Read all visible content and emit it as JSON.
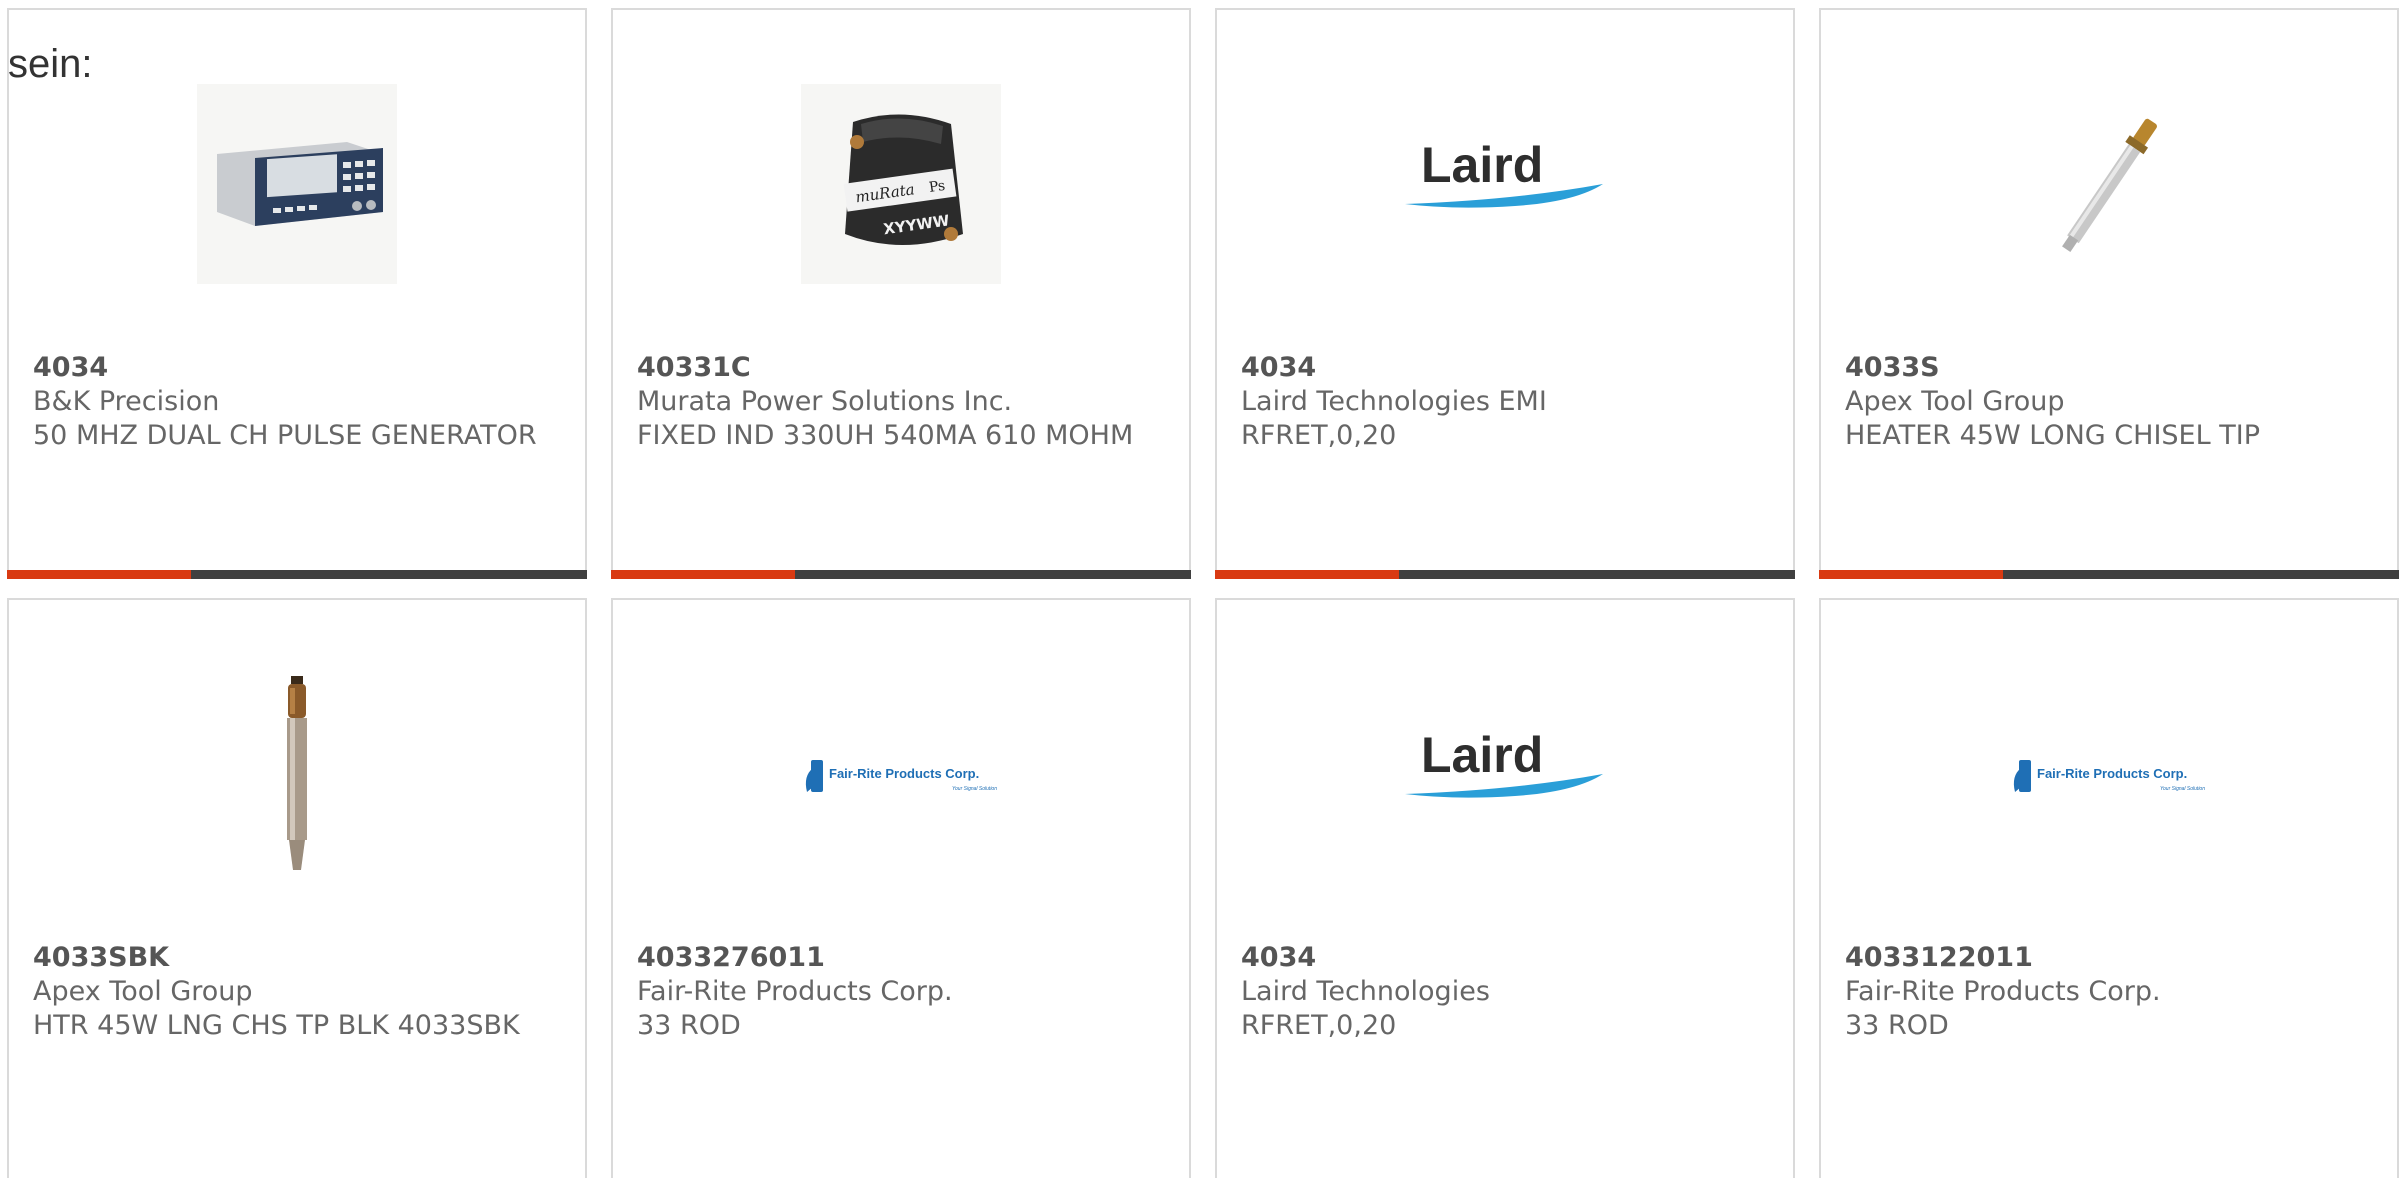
{
  "heading": "sein:",
  "colors": {
    "accent": "#d93a12",
    "bar": "#404040",
    "border": "#dadada",
    "laird_blue": "#2a9fd8",
    "fairrite_blue": "#1f6fb5"
  },
  "products": [
    {
      "part_number": "4034",
      "manufacturer": "B&K Precision",
      "description": "50 MHZ DUAL CH PULSE GENERATOR",
      "image_icon": "pulse-generator-icon"
    },
    {
      "part_number": "40331C",
      "manufacturer": "Murata Power Solutions Inc.",
      "description": "FIXED IND 330UH 540MA 610 MOHM",
      "image_icon": "inductor-icon",
      "image_text": [
        "muRata",
        "Ps",
        "XYYWW"
      ]
    },
    {
      "part_number": "4034",
      "manufacturer": "Laird Technologies EMI",
      "description": "RFRET,0,20",
      "image_icon": "laird-logo-icon",
      "image_text": [
        "Laird"
      ]
    },
    {
      "part_number": "4033S",
      "manufacturer": "Apex Tool Group",
      "description": "HEATER 45W LONG CHISEL TIP",
      "image_icon": "soldering-heater-icon"
    },
    {
      "part_number": "4033SBK",
      "manufacturer": "Apex Tool Group",
      "description": "HTR 45W LNG CHS TP BLK 4033SBK",
      "image_icon": "soldering-tip-icon"
    },
    {
      "part_number": "4033276011",
      "manufacturer": "Fair-Rite Products Corp.",
      "description": "33 ROD",
      "image_icon": "fair-rite-logo-icon",
      "image_text": [
        "Fair-Rite Products Corp.",
        "Your Signal Solution"
      ]
    },
    {
      "part_number": "4034",
      "manufacturer": "Laird Technologies",
      "description": "RFRET,0,20",
      "image_icon": "laird-logo-icon",
      "image_text": [
        "Laird"
      ]
    },
    {
      "part_number": "4033122011",
      "manufacturer": "Fair-Rite Products Corp.",
      "description": "33 ROD",
      "image_icon": "fair-rite-logo-icon",
      "image_text": [
        "Fair-Rite Products Corp.",
        "Your Signal Solution"
      ]
    }
  ]
}
